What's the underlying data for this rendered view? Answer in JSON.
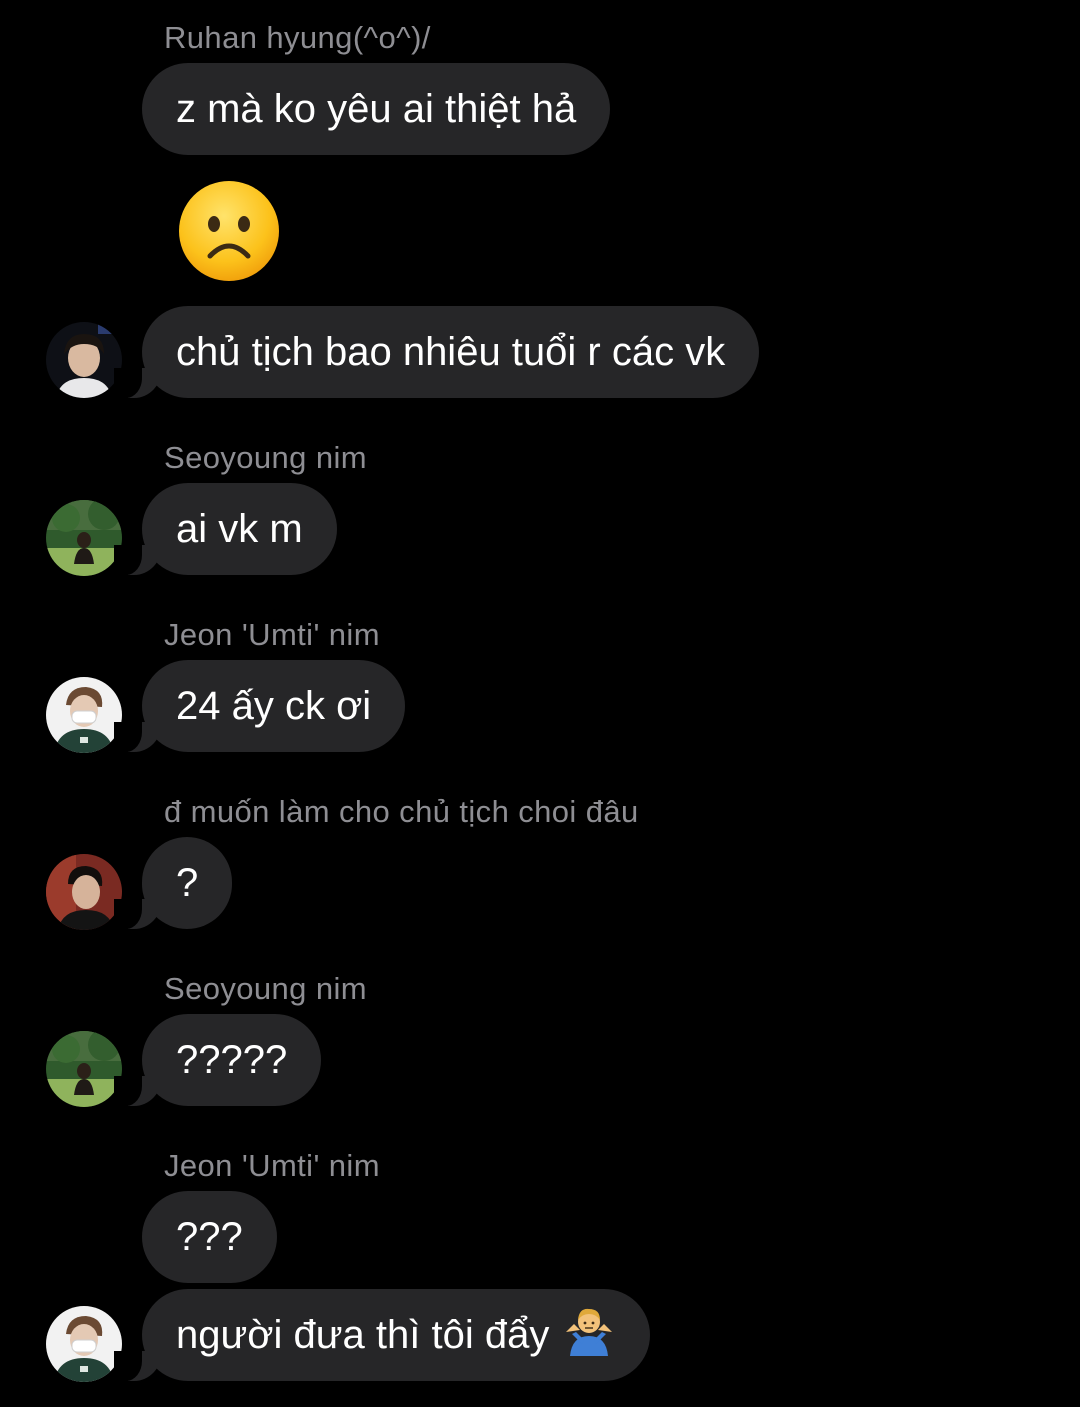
{
  "messages": {
    "m1": {
      "sender": "Ruhan hyung(^o^)/",
      "text": "z mà ko yêu ai thiệt hả"
    },
    "m2": {
      "emoji": "frowning-face-emoji"
    },
    "m3": {
      "text": "chủ tịch bao nhiêu tuổi r các vk"
    },
    "m4": {
      "sender": "Seoyoung nim",
      "text": "ai vk m"
    },
    "m5": {
      "sender": "Jeon 'Umti' nim",
      "text": "24 ấy ck ơi"
    },
    "m6": {
      "sender": "đ muốn làm cho chủ tịch choi đâu",
      "text": "?"
    },
    "m7": {
      "sender": "Seoyoung nim",
      "text": "?????"
    },
    "m8": {
      "sender": "Jeon 'Umti' nim",
      "text": "???"
    },
    "m9": {
      "text": "người đưa thì tôi đẩy",
      "emoji": "person-shrugging-emoji"
    }
  },
  "colors": {
    "background": "#000000",
    "bubble": "#262628",
    "sender_name": "#8e8e93",
    "message_text": "#ffffff"
  }
}
